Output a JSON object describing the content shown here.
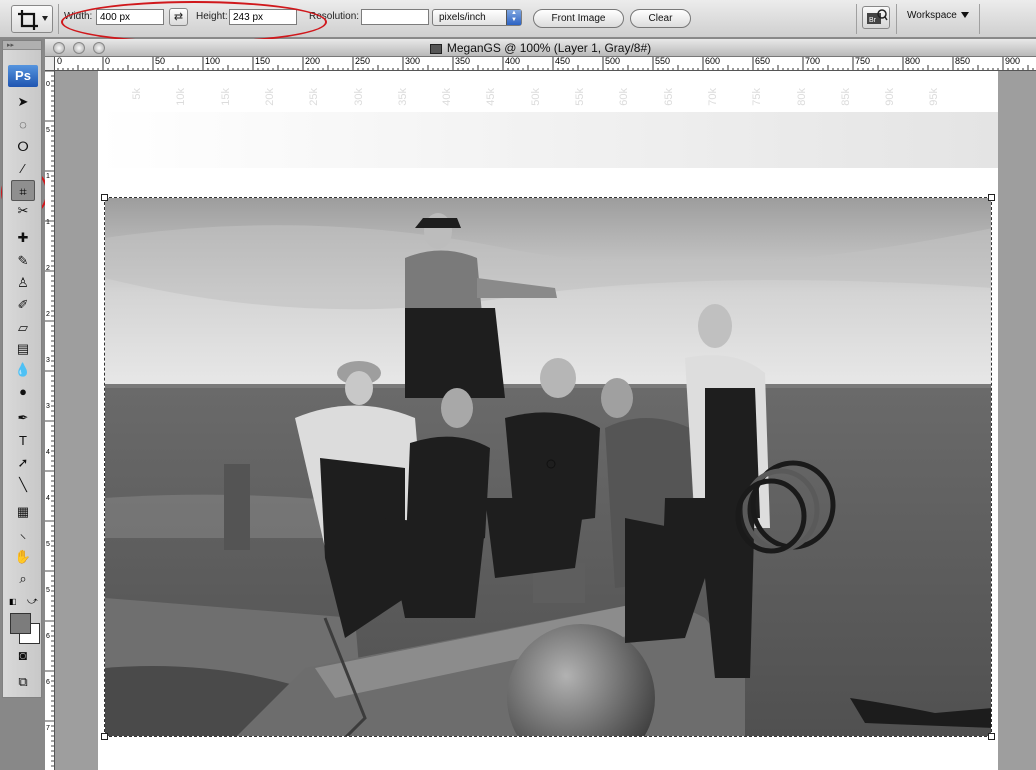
{
  "options_bar": {
    "width_label": "Width:",
    "width_value": "400 px",
    "height_label": "Height:",
    "height_value": "243 px",
    "resolution_label": "Resolution:",
    "resolution_value": "",
    "resolution_unit": "pixels/inch",
    "front_image_label": "Front Image",
    "clear_label": "Clear",
    "workspace_label": "Workspace"
  },
  "toolbox": {
    "logo": "Ps",
    "tools": [
      {
        "name": "move-tool",
        "glyph": "➤"
      },
      {
        "name": "marquee-tool",
        "glyph": "◌"
      },
      {
        "name": "lasso-tool",
        "glyph": "ⵔ"
      },
      {
        "name": "magic-wand-tool",
        "glyph": "⁄"
      },
      {
        "name": "crop-tool",
        "glyph": "⌗",
        "active": true
      },
      {
        "name": "slice-tool",
        "glyph": "✂"
      },
      {
        "name": "healing-brush-tool",
        "glyph": "✚"
      },
      {
        "name": "brush-tool",
        "glyph": "✎"
      },
      {
        "name": "clone-stamp-tool",
        "glyph": "♙"
      },
      {
        "name": "history-brush-tool",
        "glyph": "✐"
      },
      {
        "name": "eraser-tool",
        "glyph": "▱"
      },
      {
        "name": "gradient-tool",
        "glyph": "▤"
      },
      {
        "name": "blur-tool",
        "glyph": "💧"
      },
      {
        "name": "dodge-tool",
        "glyph": "●"
      },
      {
        "name": "pen-tool",
        "glyph": "✒"
      },
      {
        "name": "type-tool",
        "glyph": "T"
      },
      {
        "name": "path-selection-tool",
        "glyph": "➚"
      },
      {
        "name": "line-tool",
        "glyph": "╲"
      },
      {
        "name": "notes-tool",
        "glyph": "▦"
      },
      {
        "name": "eyedropper-tool",
        "glyph": "⸜"
      },
      {
        "name": "hand-tool",
        "glyph": "✋"
      },
      {
        "name": "zoom-tool",
        "glyph": "⌕"
      }
    ]
  },
  "document": {
    "title": "MeganGS @ 100% (Layer 1, Gray/8#)",
    "ruler_labels": [
      "0",
      "50",
      "100",
      "150",
      "200",
      "250",
      "300",
      "350",
      "400",
      "450",
      "500",
      "550",
      "600",
      "650",
      "700",
      "750",
      "800",
      "850",
      "900"
    ],
    "vruler_labels": [
      "0",
      "5",
      "1",
      "1",
      "2",
      "2",
      "3",
      "3",
      "4",
      "4",
      "5",
      "5",
      "6",
      "6",
      "7"
    ],
    "watermark_labels": [
      "5k",
      "10k",
      "15k",
      "20k",
      "25k",
      "30k",
      "35k",
      "40k",
      "45k",
      "50k",
      "55k",
      "60k",
      "65k",
      "70k",
      "75k",
      "80k",
      "85k",
      "90k",
      "95k"
    ]
  },
  "colors": {
    "annotation_red": "#d0181c",
    "ps_blue": "#1f55b1"
  }
}
